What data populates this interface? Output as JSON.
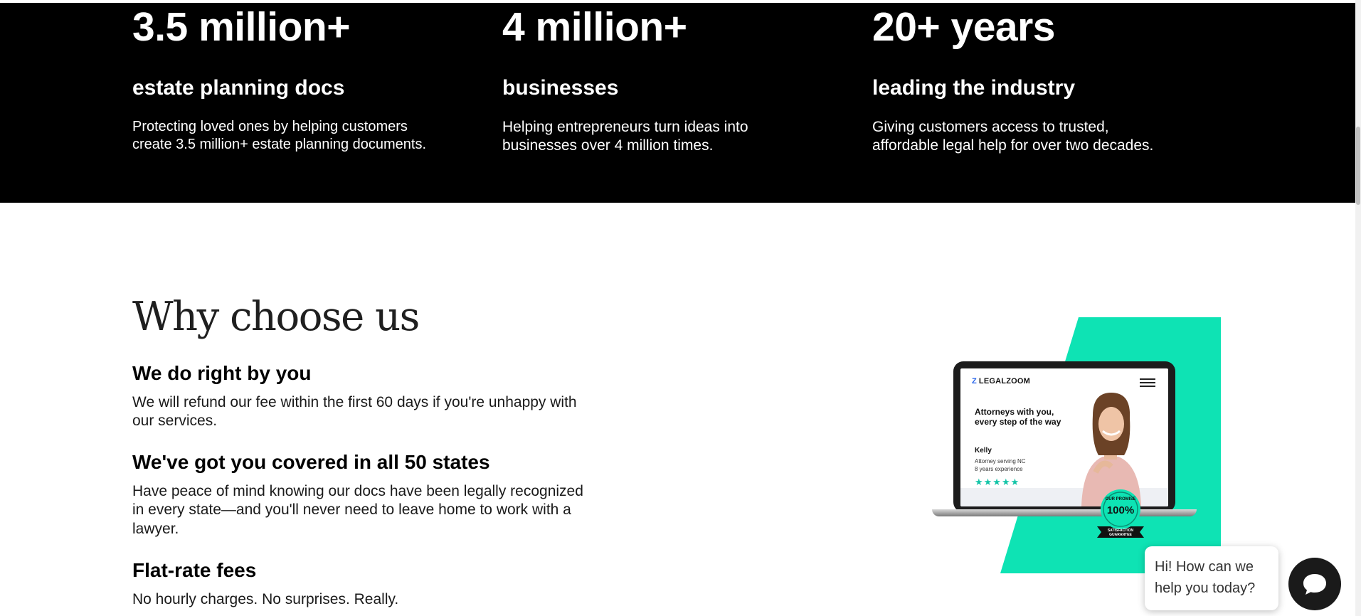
{
  "stats": [
    {
      "big": "3.5 million+",
      "sub": "estate planning docs",
      "desc_line1": "Protecting loved ones by helping customers",
      "desc_line2": "create 3.5 million+ estate planning documents."
    },
    {
      "big": "4 million+",
      "sub": "businesses",
      "desc_line1": "Helping entrepreneurs turn ideas into",
      "desc_line2": "businesses over 4 million times."
    },
    {
      "big": "20+ years",
      "sub": "leading the industry",
      "desc_line1": "Giving customers access to trusted,",
      "desc_line2": "affordable legal help for over two decades."
    }
  ],
  "why": {
    "title": "Why choose us",
    "items": [
      {
        "heading": "We do right by you",
        "text_line1": "We will refund our fee within the first 60 days if you're unhappy with",
        "text_line2": "our services."
      },
      {
        "heading": "We've got you covered in all 50 states",
        "text_line1": "Have peace of mind knowing our docs have been legally recognized",
        "text_line2": "in every state—and you'll never need to leave home to work with a",
        "text_line3": "lawyer."
      },
      {
        "heading": "Flat-rate fees",
        "text_line1": "No hourly charges. No surprises. Really."
      }
    ]
  },
  "illustration": {
    "logo": "LEGALZOOM",
    "headline": "Attorneys with you, every step of the way",
    "attorney_name": "Kelly",
    "attorney_line1": "Attorney serving NC",
    "attorney_line2": "8 years experience",
    "stars": "★★★★★",
    "badge_top": "OUR PROMISE",
    "badge_mid": "100%",
    "badge_bottom1": "SATISFACTION",
    "badge_bottom2": "GUARANTEE"
  },
  "chat": {
    "bubble_line1": "Hi! How can we",
    "bubble_line2": "help you today?"
  },
  "colors": {
    "teal": "#0ee3b4",
    "band": "#000000",
    "star": "#12c4a7"
  },
  "icons": {
    "chat": "chat-bubble-icon",
    "menu": "hamburger-menu-icon"
  }
}
